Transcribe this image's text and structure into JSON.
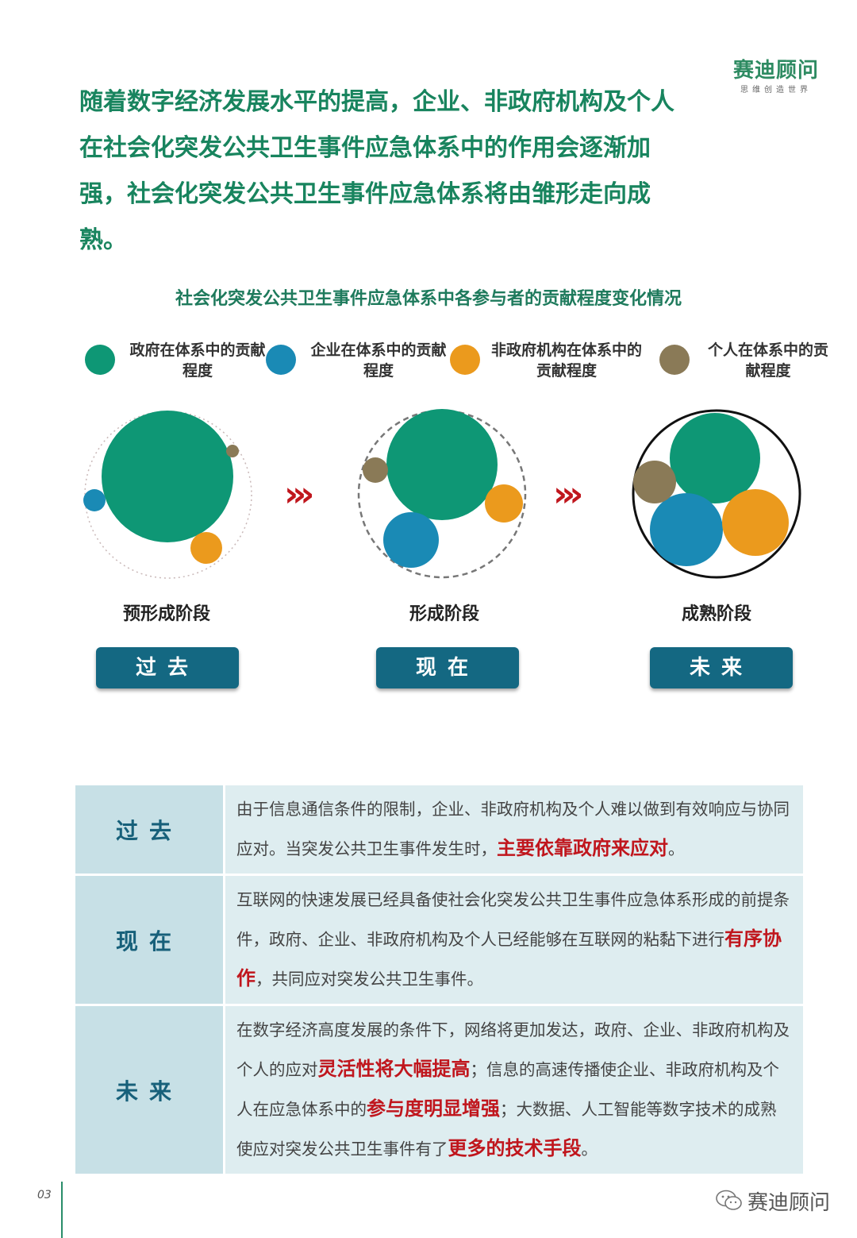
{
  "logo": {
    "name": "赛迪顾问",
    "tagline": "思维创造世界"
  },
  "headline": "随着数字经济发展水平的提高，企业、非政府机构及个人在社会化突发公共卫生事件应急体系中的作用会逐渐加强，社会化突发公共卫生事件应急体系将由雏形走向成熟。",
  "chart_title": "社会化突发公共卫生事件应急体系中各参与者的贡献程度变化情况",
  "legend": [
    {
      "label": "政府在体系中的贡献程度",
      "color": "#0e9775"
    },
    {
      "label": "企业在体系中的贡献程度",
      "color": "#1a8ab5"
    },
    {
      "label": "非政府机构在体系中的贡献程度",
      "color": "#eb9a1d"
    },
    {
      "label": "个人在体系中的贡献程度",
      "color": "#8a7a57"
    }
  ],
  "stages": [
    {
      "label": "预形成阶段",
      "era": "过去"
    },
    {
      "label": "形成阶段",
      "era": "现在"
    },
    {
      "label": "成熟阶段",
      "era": "未来"
    }
  ],
  "arrows": "›››",
  "table": [
    {
      "era": "过去",
      "segments": [
        {
          "text": "由于信息通信条件的限制，企业、非政府机构及个人难以做到有效响应与协同应对。当突发公共卫生事件发生时，",
          "hl": false
        },
        {
          "text": "主要依靠政府来应对",
          "hl": true
        },
        {
          "text": "。",
          "hl": false
        }
      ]
    },
    {
      "era": "现在",
      "segments": [
        {
          "text": "互联网的快速发展已经具备使社会化突发公共卫生事件应急体系形成的前提条件，政府、企业、非政府机构及个人已经能够在互联网的粘黏下进行",
          "hl": false
        },
        {
          "text": "有序协作",
          "hl": true
        },
        {
          "text": "，共同应对突发公共卫生事件。",
          "hl": false
        }
      ]
    },
    {
      "era": "未来",
      "segments": [
        {
          "text": "在数字经济高度发展的条件下，网络将更加发达，政府、企业、非政府机构及个人的应对",
          "hl": false
        },
        {
          "text": "灵活性将大幅提高",
          "hl": true
        },
        {
          "text": "；信息的高速传播使企业、非政府机构及个人在应急体系中的",
          "hl": false
        },
        {
          "text": "参与度明显增强",
          "hl": true
        },
        {
          "text": "；大数据、人工智能等数字技术的成熟使应对突发公共卫生事件有了",
          "hl": false
        },
        {
          "text": "更多的技术手段",
          "hl": true
        },
        {
          "text": "。",
          "hl": false
        }
      ]
    }
  ],
  "page_number": "03",
  "wechat_name": "赛迪顾问"
}
